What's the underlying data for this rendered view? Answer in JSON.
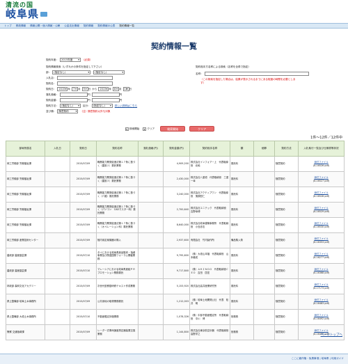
{
  "logo": {
    "line1": "清流の国",
    "line2": "岐阜県"
  },
  "breadcrumb": [
    "トップ",
    "県政情報",
    "情報公開・個人情報・公聴",
    "公金支出情報",
    "契約情報",
    "契約情報の公表",
    "契約情報一覧"
  ],
  "page_title": "契約情報一覧",
  "form": {
    "fiscal_label": "契約年度：",
    "fiscal_value": "2015年度",
    "required": "（必須）",
    "type_label": "契約情報検索（いずれかの条件を指定して下さい）",
    "dept_option": "(指定なし)",
    "section_option": "(指定なし)",
    "bureau_label": "入札店：",
    "dept_label": "部：",
    "name_label": "契約名：",
    "date_label": "契約日：",
    "y1": "2015",
    "m1": "7",
    "d1": "9",
    "y2": "2015",
    "m2": "8",
    "d2": "16",
    "nen": "年",
    "gatsu": "月",
    "nichi": "日",
    "kara": "から",
    "price_label": "落札価格：",
    "price_label2": "契約金額：",
    "yen": "円",
    "method_label": "契約方法：",
    "method_option": "(指定なし)",
    "category_label": "区分：",
    "detail_link": "詳しい説明はこちら",
    "sort_label": "並び順：",
    "sort_option": "随意契約",
    "sort_note": "（注）随意契約以外も対象",
    "right_title": "契約相手方名称による検索（名称を全角で指定）",
    "right_label": "名称：",
    "right_note": "（この検索を指定した場合は、結果が表示されるまでにある程度の時間を必要とします）"
  },
  "actions": {
    "search_check": "検索開始",
    "clear_check": "クリア",
    "search_button": "検索開始",
    "clear_button": "クリア"
  },
  "count": "1件～12件／12件中",
  "columns": [
    "部局所属名",
    "入札日",
    "契約日",
    "契約名称",
    "落札価格(円)",
    "契約金額(円)",
    "契約相手名称",
    "類",
    "細節",
    "契約方法",
    "入札執行一覧及び仕様書等状況"
  ],
  "rows": [
    {
      "dept": "岡工労働部 労働福祉課",
      "bid": "",
      "date": "2015/07/09",
      "name": "職業能力開発促進法第１７条に基づく（建設２）委託業務",
      "price": "",
      "amount": "4,909,200",
      "partner": "株式会社インフォアー上　代表取締役　北嶋",
      "cat": "委託料",
      "sub": "",
      "method": "随意契約",
      "file": "添付ファイル",
      "size": "(8.16526 pdf)"
    },
    {
      "dept": "岡工労働部 労働福祉課",
      "bid": "",
      "date": "2015/07/09",
      "name": "職業能力開発促進法第１７条に基づく（建設３）委託業務",
      "price": "",
      "amount": "2,430,000",
      "partner": "株式会社八重垣　代表取締役　三重一幸",
      "cat": "委託料",
      "sub": "",
      "method": "随意契約",
      "file": "添付ファイル",
      "size": "(8.16527 pdf)"
    },
    {
      "dept": "岡工労働部 労働福祉課",
      "bid": "",
      "date": "2015/07/09",
      "name": "職業能力開発促進法第１７条に基づく（介護）委託業務",
      "price": "",
      "amount": "3,240,000",
      "partner": "株式会社アクティブワン　代表取締役　鬼頭哲仁",
      "cat": "委託料",
      "sub": "",
      "method": "随意契約",
      "file": "添付ファイル",
      "size": "(8.16528 pdf)"
    },
    {
      "dept": "岡工労働部 労働福祉課",
      "bid": "",
      "date": "2015/07/09",
      "name": "職業能力開発促進法第１７条に基づく（パソコン　CADマスター科）委託業務",
      "price": "",
      "amount": "2,700,640",
      "partner": "株式会社ユニテック　代表取締役　吉野幸博",
      "cat": "委託料",
      "sub": "",
      "method": "随意契約",
      "file": "添付ファイル",
      "size": "(8.16529 pdf)"
    },
    {
      "dept": "岡工労働部 労働福祉課",
      "bid": "",
      "date": "2015/07/09",
      "name": "職業能力開発促進法第１７条に基づく（オペレーション科）委託業務",
      "price": "",
      "amount": "8,640,000",
      "partner": "株式会社岐阜建築事務所　代表取締役　小島忠志",
      "cat": "委託料",
      "sub": "",
      "method": "随意契約",
      "file": "添付ファイル",
      "size": "(8.16530 pdf)"
    },
    {
      "dept": "岡工労働部 産業技術センター",
      "bid": "",
      "date": "2015/07/09",
      "name": "陸内用定案機器の購入",
      "price": "",
      "amount": "2,937,600",
      "partner": "有限会社　竹内製作所",
      "cat": "備品購入費",
      "sub": "",
      "method": "随意契約",
      "file": "添付ファイル",
      "size": "(8.16353 pdf)"
    },
    {
      "dept": "農政部 農産園芸課",
      "bid": "",
      "date": "2015/07/10",
      "name": "タイにおける岐阜県産品販売・指導事業及び関連国際フォーラム開催業務",
      "price": "",
      "amount": "9,795,600",
      "partner": "（株）大垣山本福　代表取締役　山本義成",
      "cat": "委託料",
      "sub": "",
      "method": "随意契約",
      "file": "添付ファイル",
      "size": "(8.16277 pdf)"
    },
    {
      "dept": "農政部 農産園芸課",
      "bid": "",
      "date": "2015/07/10",
      "name": "マレーシアにおける岐阜県産鮎ＰＲプロモーション業務委託",
      "price": "",
      "amount": "9,717,840",
      "partner": "（株）ＡＫＩＮＤＯ　代表取締役ＣＥＯ　吉田　匡宏",
      "cat": "委託料",
      "sub": "",
      "method": "随意契約",
      "file": "添付ファイル",
      "size": "(8.16368 pdf)"
    },
    {
      "dept": "林政部 森林文化アカデミー",
      "bid": "",
      "date": "2015/07/09",
      "name": "次世代型移動研修テキスト作成業務",
      "price": "",
      "amount": "5,153,920",
      "partner": "株式会社高井産業研究所",
      "cat": "委託料",
      "sub": "",
      "method": "随意契約",
      "file": "添付ファイル",
      "size": "(8.17173 pdf)"
    },
    {
      "dept": "県土整備部 岐阜土木事務所",
      "bid": "",
      "date": "2015/07/09",
      "name": "公共用地の取得業務委託",
      "price": "",
      "amount": "1,212,003",
      "partner": "（株）岐阜土地開発公社　代表　松井　明",
      "cat": "委託料",
      "sub": "",
      "method": "随意契約",
      "file": "添付ファイル",
      "size": "(8.16483 pdf)"
    },
    {
      "dept": "県土整備部 大垣土木事務所",
      "bid": "",
      "date": "2015/07/10",
      "name": "不動産鑑定評価業務",
      "price": "",
      "amount": "1,078,326",
      "partner": "（株）中部不動産鑑定所　代表取締役　中川　博",
      "cat": "役務費",
      "sub": "",
      "method": "随意契約",
      "file": "添付ファイル",
      "size": "(8.16492 pdf)"
    },
    {
      "dept": "警察 交通指導課",
      "bid": "",
      "date": "2015/07/09",
      "name": "レーダー式車両速度測定器装置交換業務",
      "price": "",
      "amount": "1,144,800",
      "partner": "株式会社東京航空計器　代表取締役　高野洋之",
      "cat": "役務費",
      "sub": "",
      "method": "随意契約",
      "file": "添付ファイル",
      "size": "(8.16490 pdf)"
    }
  ],
  "top_link": "ページトップへ",
  "footer": "ここに著作権・免責事項 | 岐阜県 | 利用ガイド"
}
